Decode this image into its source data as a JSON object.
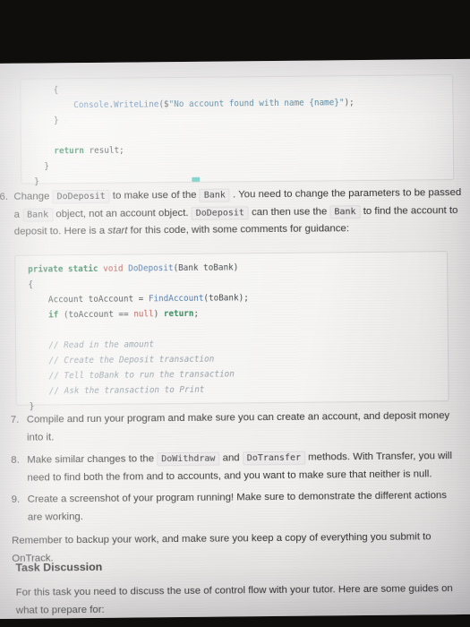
{
  "document": {
    "code_block_top": {
      "lines": [
        {
          "indent": 4,
          "segments": [
            {
              "t": "{",
              "c": "pln"
            }
          ]
        },
        {
          "indent": 8,
          "segments": [
            {
              "t": "Console",
              "c": "typ"
            },
            {
              "t": ".",
              "c": "pln"
            },
            {
              "t": "WriteLine",
              "c": "typ"
            },
            {
              "t": "($",
              "c": "pln"
            },
            {
              "t": "\"No account found with name {name}\"",
              "c": "str"
            },
            {
              "t": ");",
              "c": "pln"
            }
          ]
        },
        {
          "indent": 4,
          "segments": [
            {
              "t": "}",
              "c": "pln"
            }
          ]
        },
        {
          "indent": 0,
          "segments": [
            {
              "t": "",
              "c": "pln"
            }
          ]
        },
        {
          "indent": 4,
          "segments": [
            {
              "t": "return",
              "c": "kw"
            },
            {
              "t": " result;",
              "c": "pln"
            }
          ]
        },
        {
          "indent": 2,
          "segments": [
            {
              "t": "}",
              "c": "pln"
            }
          ]
        },
        {
          "indent": 0,
          "segments": [
            {
              "t": "}",
              "c": "pln"
            }
          ]
        }
      ],
      "raw": "    {\n        Console.WriteLine($\"No account found with name {name}\");\n    }\n\n    return result;\n  }\n}"
    },
    "task_6": {
      "number": "6.",
      "parts": [
        {
          "type": "text",
          "value": "Change "
        },
        {
          "type": "code",
          "value": "DoDeposit"
        },
        {
          "type": "text",
          "value": " to make use of the "
        },
        {
          "type": "code",
          "value": "Bank"
        },
        {
          "type": "text",
          "value": " . You need to change the parameters to be passed a "
        },
        {
          "type": "code",
          "value": "Bank"
        },
        {
          "type": "text",
          "value": " object, not an account object. "
        },
        {
          "type": "code",
          "value": "DoDeposit"
        },
        {
          "type": "text",
          "value": " can then use the "
        },
        {
          "type": "code",
          "value": "Bank"
        },
        {
          "type": "text",
          "value": " to find the account to deposit to. Here is a "
        },
        {
          "type": "italic",
          "value": "start"
        },
        {
          "type": "text",
          "value": " for this code, with some comments for guidance:"
        }
      ]
    },
    "code_block_deposit": {
      "lines": [
        {
          "indent": 0,
          "segments": [
            {
              "t": "private static ",
              "c": "kw"
            },
            {
              "t": "void",
              "c": "kwr"
            },
            {
              "t": " ",
              "c": "pln"
            },
            {
              "t": "DoDeposit",
              "c": "typ"
            },
            {
              "t": "(Bank toBank)",
              "c": "pln"
            }
          ]
        },
        {
          "indent": 0,
          "segments": [
            {
              "t": "{",
              "c": "pln"
            }
          ]
        },
        {
          "indent": 4,
          "segments": [
            {
              "t": "Account toAccount = ",
              "c": "pln"
            },
            {
              "t": "FindAccount",
              "c": "typ"
            },
            {
              "t": "(toBank);",
              "c": "pln"
            }
          ]
        },
        {
          "indent": 4,
          "segments": [
            {
              "t": "if",
              "c": "kw"
            },
            {
              "t": " (toAccount == ",
              "c": "pln"
            },
            {
              "t": "null",
              "c": "kwr"
            },
            {
              "t": ") ",
              "c": "pln"
            },
            {
              "t": "return",
              "c": "kw"
            },
            {
              "t": ";",
              "c": "pln"
            }
          ]
        },
        {
          "indent": 0,
          "segments": [
            {
              "t": "",
              "c": "pln"
            }
          ]
        },
        {
          "indent": 4,
          "segments": [
            {
              "t": "// Read in the amount",
              "c": "cmt"
            }
          ]
        },
        {
          "indent": 4,
          "segments": [
            {
              "t": "// Create the Deposit transaction",
              "c": "cmt"
            }
          ]
        },
        {
          "indent": 4,
          "segments": [
            {
              "t": "// Tell toBank to run the transaction",
              "c": "cmt"
            }
          ]
        },
        {
          "indent": 4,
          "segments": [
            {
              "t": "// Ask the transaction to Print",
              "c": "cmt"
            }
          ]
        },
        {
          "indent": 0,
          "segments": [
            {
              "t": "}",
              "c": "pln"
            }
          ]
        }
      ],
      "raw": "private static void DoDeposit(Bank toBank)\n{\n    Account toAccount = FindAccount(toBank);\n    if (toAccount == null) return;\n\n    // Read in the amount\n    // Create the Deposit transaction\n    // Tell toBank to run the transaction\n    // Ask the transaction to Print\n}"
    },
    "task_7": {
      "number": "7.",
      "parts": [
        {
          "type": "text",
          "value": "Compile and run your program and make sure you can create an account, and deposit money into it."
        }
      ]
    },
    "task_8": {
      "number": "8.",
      "parts": [
        {
          "type": "text",
          "value": "Make similar changes to the "
        },
        {
          "type": "code",
          "value": "DoWithdraw"
        },
        {
          "type": "text",
          "value": " and "
        },
        {
          "type": "code",
          "value": "DoTransfer"
        },
        {
          "type": "text",
          "value": " methods. With Transfer, you will need to find both the from and to accounts, and you want to make sure that neither is null."
        }
      ]
    },
    "task_9": {
      "number": "9.",
      "parts": [
        {
          "type": "text",
          "value": "Create a screenshot of your program running! Make sure to demonstrate the different actions are working."
        }
      ]
    },
    "remember_note": "Remember to backup your work, and make sure you keep a copy of everything you submit to OnTrack.",
    "discussion_heading": "Task Discussion",
    "discussion_body": "For this task you need to discuss the use of control flow with your tutor. Here are some guides on what to prepare for:",
    "copy_chip": {
      "name": "copy-code-marker",
      "color": "#5fc8c0"
    }
  },
  "colors": {
    "page_background": "#f2f0ee",
    "bezel": "#100e0d",
    "code_background": "#f6f5f3",
    "code_border": "#dcdcdc",
    "keyword": "#1f7a4a",
    "keyword_alt": "#b4473c",
    "type": "#3b6ea5",
    "string": "#2d6e8e",
    "comment": "#8d9aa3",
    "body_text": "#2e2e2e",
    "accent_teal": "#5fc8c0"
  }
}
